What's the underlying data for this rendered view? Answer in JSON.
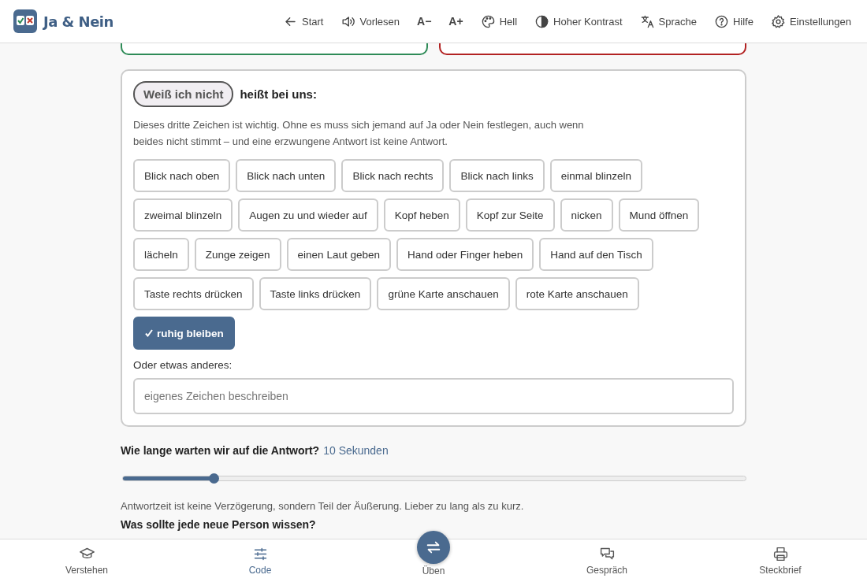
{
  "app": {
    "title": "Ja & Nein"
  },
  "toolbar": [
    {
      "kind": "back",
      "label": "Start"
    },
    {
      "kind": "speaker",
      "label": "Vorlesen"
    },
    {
      "kind": "text",
      "label": "A−"
    },
    {
      "kind": "text",
      "label": "A+"
    },
    {
      "kind": "palette",
      "label": "Hell"
    },
    {
      "kind": "contrast",
      "label": "Hoher Kontrast"
    },
    {
      "kind": "translate",
      "label": "Sprache"
    },
    {
      "kind": "help",
      "label": "Hilfe"
    },
    {
      "kind": "gear",
      "label": "Einstellungen"
    }
  ],
  "answer_cards": [
    {
      "color": "#2e8b57"
    },
    {
      "color": "#b22222"
    }
  ],
  "unknown_panel": {
    "badge": "Weiß ich nicht",
    "heading": "heißt bei uns:",
    "description": "Dieses dritte Zeichen ist wichtig. Ohne es muss sich jemand auf Ja oder Nein festlegen, auch wenn beides nicht stimmt – und eine erzwungene Antwort ist keine Antwort.",
    "signs": [
      {
        "label": "Blick nach oben",
        "selected": false
      },
      {
        "label": "Blick nach unten",
        "selected": false
      },
      {
        "label": "Blick nach rechts",
        "selected": false
      },
      {
        "label": "Blick nach links",
        "selected": false
      },
      {
        "label": "einmal blinzeln",
        "selected": false
      },
      {
        "label": "zweimal blinzeln",
        "selected": false
      },
      {
        "label": "Augen zu und wieder auf",
        "selected": false
      },
      {
        "label": "Kopf heben",
        "selected": false
      },
      {
        "label": "Kopf zur Seite",
        "selected": false
      },
      {
        "label": "nicken",
        "selected": false
      },
      {
        "label": "Mund öffnen",
        "selected": false
      },
      {
        "label": "lächeln",
        "selected": false
      },
      {
        "label": "Zunge zeigen",
        "selected": false
      },
      {
        "label": "einen Laut geben",
        "selected": false
      },
      {
        "label": "Hand oder Finger heben",
        "selected": false
      },
      {
        "label": "Hand auf den Tisch",
        "selected": false
      },
      {
        "label": "Taste rechts drücken",
        "selected": false
      },
      {
        "label": "Taste links drücken",
        "selected": false
      },
      {
        "label": "grüne Karte anschauen",
        "selected": false
      },
      {
        "label": "rote Karte anschauen",
        "selected": false
      },
      {
        "label": "ruhig bleiben",
        "selected": true
      }
    ],
    "other_label": "Oder etwas anderes:",
    "other_placeholder": "eigenes Zeichen beschreiben"
  },
  "wait": {
    "question": "Wie lange warten wir auf die Antwort?",
    "value": "10 Sekunden",
    "level": 0.145,
    "note": "Antwortzeit ist keine Verzögerung, sondern Teil der Äußerung. Lieber zu lang als zu kurz."
  },
  "next_heading": "Was sollte jede neue Person wissen?",
  "bottom_nav": [
    {
      "kind": "cap",
      "label": "Verstehen",
      "selected": false
    },
    {
      "kind": "sliders",
      "label": "Code",
      "selected": true
    },
    {
      "kind": "swap",
      "label": "Üben",
      "selected": false
    },
    {
      "kind": "chat",
      "label": "Gespräch",
      "selected": false
    },
    {
      "kind": "printer",
      "label": "Steckbrief",
      "selected": false
    }
  ]
}
